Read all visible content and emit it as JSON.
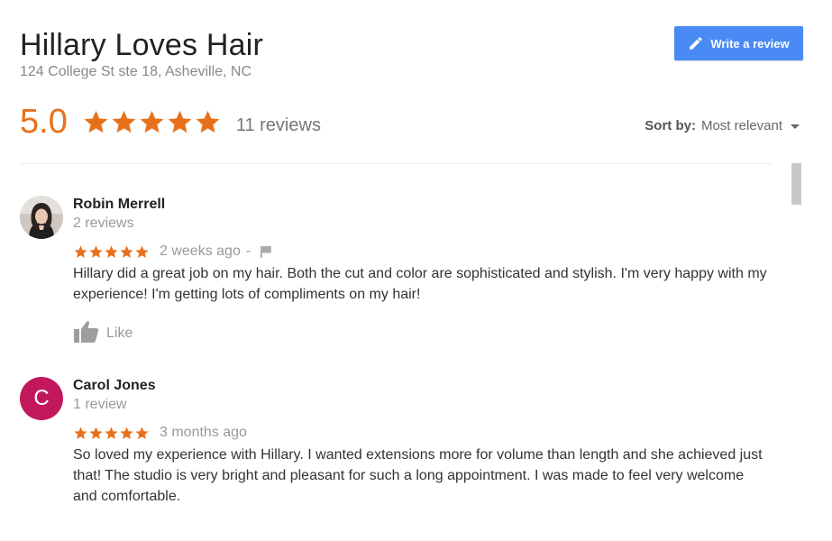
{
  "business": {
    "name": "Hillary Loves Hair",
    "address": "124 College St ste 18, Asheville, NC"
  },
  "write_review": {
    "label": "Write a review",
    "icon": "pencil-icon",
    "color": "#4a8af4"
  },
  "rating": {
    "value": "5.0",
    "stars": 5,
    "count_label": "11 reviews",
    "star_color": "#e7711b"
  },
  "sort": {
    "label": "Sort by:",
    "value": "Most relevant"
  },
  "reviews": [
    {
      "author": "Robin Merrell",
      "author_meta": "2 reviews",
      "avatar": "photo",
      "stars": 5,
      "time": "2 weeks ago",
      "separator": "-",
      "text": "Hillary did a great job on my hair. Both the cut and color are sophisticated and stylish. I'm very happy with my experience!  I'm getting lots of compliments on my hair!",
      "like_label": "Like"
    },
    {
      "author": "Carol Jones",
      "author_meta": "1 review",
      "avatar_letter": "C",
      "avatar_color": "#c2185b",
      "stars": 5,
      "time": "3 months ago",
      "text": "So loved my experience with Hillary. I wanted extensions more for volume than length and she achieved just that! The studio is very bright and pleasant for such a long appointment. I was made to feel very welcome and comfortable."
    }
  ]
}
